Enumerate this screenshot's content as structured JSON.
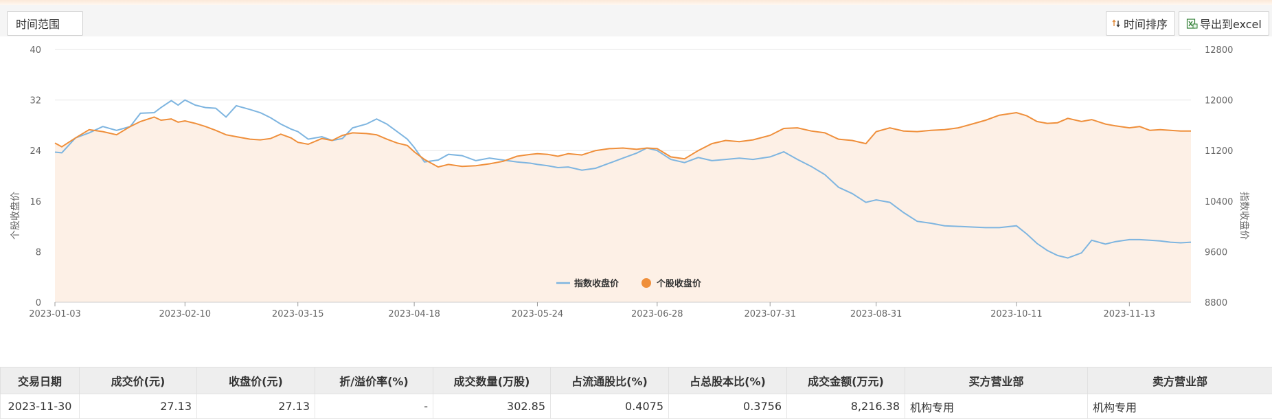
{
  "toolbar": {
    "range_label": "时间范围",
    "sort_label": "时间排序",
    "export_label": "导出到excel"
  },
  "chart_data": {
    "type": "line",
    "x_ticks": [
      "2023-01-03",
      "2023-02-10",
      "2023-03-15",
      "2023-04-18",
      "2023-05-24",
      "2023-06-28",
      "2023-07-31",
      "2023-08-31",
      "2023-10-11",
      "2023-11-13"
    ],
    "x_range": [
      "2023-01-03",
      "2023-12-01"
    ],
    "y_left": {
      "label": "个股收盘价",
      "range": [
        0,
        40
      ],
      "ticks": [
        0,
        8,
        16,
        24,
        32,
        40
      ]
    },
    "y_right": {
      "label": "指数收盘价",
      "range": [
        8800,
        12800
      ],
      "ticks": [
        8800,
        9600,
        10400,
        11200,
        12000,
        12800
      ]
    },
    "grid": true,
    "legend_position": "bottom-center",
    "series": [
      {
        "name": "指数收盘价",
        "axis": "right",
        "color": "#7eb5e0",
        "points": [
          [
            "2023-01-03",
            11175
          ],
          [
            "2023-01-05",
            11165
          ],
          [
            "2023-01-09",
            11400
          ],
          [
            "2023-01-13",
            11480
          ],
          [
            "2023-01-17",
            11580
          ],
          [
            "2023-01-21",
            11520
          ],
          [
            "2023-01-25",
            11580
          ],
          [
            "2023-01-28",
            11790
          ],
          [
            "2023-02-01",
            11800
          ],
          [
            "2023-02-03",
            11880
          ],
          [
            "2023-02-06",
            11990
          ],
          [
            "2023-02-08",
            11920
          ],
          [
            "2023-02-10",
            12000
          ],
          [
            "2023-02-13",
            11920
          ],
          [
            "2023-02-16",
            11880
          ],
          [
            "2023-02-19",
            11870
          ],
          [
            "2023-02-22",
            11730
          ],
          [
            "2023-02-25",
            11910
          ],
          [
            "2023-03-01",
            11850
          ],
          [
            "2023-03-04",
            11800
          ],
          [
            "2023-03-07",
            11720
          ],
          [
            "2023-03-10",
            11620
          ],
          [
            "2023-03-13",
            11540
          ],
          [
            "2023-03-15",
            11500
          ],
          [
            "2023-03-18",
            11380
          ],
          [
            "2023-03-22",
            11420
          ],
          [
            "2023-03-25",
            11360
          ],
          [
            "2023-03-28",
            11390
          ],
          [
            "2023-03-31",
            11560
          ],
          [
            "2023-04-04",
            11620
          ],
          [
            "2023-04-07",
            11700
          ],
          [
            "2023-04-10",
            11620
          ],
          [
            "2023-04-13",
            11500
          ],
          [
            "2023-04-16",
            11380
          ],
          [
            "2023-04-18",
            11250
          ],
          [
            "2023-04-21",
            11020
          ],
          [
            "2023-04-25",
            11050
          ],
          [
            "2023-04-28",
            11140
          ],
          [
            "2023-05-02",
            11120
          ],
          [
            "2023-05-06",
            11040
          ],
          [
            "2023-05-10",
            11080
          ],
          [
            "2023-05-14",
            11050
          ],
          [
            "2023-05-18",
            11020
          ],
          [
            "2023-05-22",
            11000
          ],
          [
            "2023-05-24",
            10980
          ],
          [
            "2023-05-27",
            10960
          ],
          [
            "2023-05-30",
            10930
          ],
          [
            "2023-06-02",
            10940
          ],
          [
            "2023-06-06",
            10890
          ],
          [
            "2023-06-10",
            10920
          ],
          [
            "2023-06-14",
            11000
          ],
          [
            "2023-06-18",
            11080
          ],
          [
            "2023-06-22",
            11160
          ],
          [
            "2023-06-25",
            11240
          ],
          [
            "2023-06-28",
            11200
          ],
          [
            "2023-07-02",
            11060
          ],
          [
            "2023-07-06",
            11010
          ],
          [
            "2023-07-10",
            11090
          ],
          [
            "2023-07-14",
            11040
          ],
          [
            "2023-07-18",
            11060
          ],
          [
            "2023-07-22",
            11080
          ],
          [
            "2023-07-26",
            11060
          ],
          [
            "2023-07-31",
            11100
          ],
          [
            "2023-08-04",
            11180
          ],
          [
            "2023-08-08",
            11060
          ],
          [
            "2023-08-12",
            10950
          ],
          [
            "2023-08-16",
            10820
          ],
          [
            "2023-08-20",
            10620
          ],
          [
            "2023-08-24",
            10520
          ],
          [
            "2023-08-28",
            10380
          ],
          [
            "2023-08-31",
            10420
          ],
          [
            "2023-09-04",
            10380
          ],
          [
            "2023-09-08",
            10220
          ],
          [
            "2023-09-12",
            10080
          ],
          [
            "2023-09-16",
            10050
          ],
          [
            "2023-09-20",
            10010
          ],
          [
            "2023-09-24",
            10000
          ],
          [
            "2023-09-28",
            9990
          ],
          [
            "2023-10-02",
            9980
          ],
          [
            "2023-10-06",
            9980
          ],
          [
            "2023-10-11",
            10010
          ],
          [
            "2023-10-14",
            9880
          ],
          [
            "2023-10-17",
            9730
          ],
          [
            "2023-10-20",
            9620
          ],
          [
            "2023-10-23",
            9540
          ],
          [
            "2023-10-26",
            9500
          ],
          [
            "2023-10-30",
            9580
          ],
          [
            "2023-11-02",
            9780
          ],
          [
            "2023-11-06",
            9720
          ],
          [
            "2023-11-09",
            9760
          ],
          [
            "2023-11-13",
            9790
          ],
          [
            "2023-11-16",
            9790
          ],
          [
            "2023-11-19",
            9780
          ],
          [
            "2023-11-22",
            9770
          ],
          [
            "2023-11-25",
            9750
          ],
          [
            "2023-11-28",
            9740
          ],
          [
            "2023-12-01",
            9750
          ]
        ]
      },
      {
        "name": "个股收盘价",
        "axis": "left",
        "color": "#ef8f3b",
        "points": [
          [
            "2023-01-03",
            25.2
          ],
          [
            "2023-01-05",
            24.6
          ],
          [
            "2023-01-09",
            26.0
          ],
          [
            "2023-01-13",
            27.3
          ],
          [
            "2023-01-17",
            27.0
          ],
          [
            "2023-01-21",
            26.5
          ],
          [
            "2023-01-25",
            27.8
          ],
          [
            "2023-01-28",
            28.6
          ],
          [
            "2023-02-01",
            29.3
          ],
          [
            "2023-02-03",
            28.8
          ],
          [
            "2023-02-06",
            29.0
          ],
          [
            "2023-02-08",
            28.5
          ],
          [
            "2023-02-10",
            28.7
          ],
          [
            "2023-02-13",
            28.3
          ],
          [
            "2023-02-16",
            27.8
          ],
          [
            "2023-02-19",
            27.2
          ],
          [
            "2023-02-22",
            26.5
          ],
          [
            "2023-02-25",
            26.2
          ],
          [
            "2023-03-01",
            25.8
          ],
          [
            "2023-03-04",
            25.7
          ],
          [
            "2023-03-07",
            25.9
          ],
          [
            "2023-03-10",
            26.6
          ],
          [
            "2023-03-13",
            26.0
          ],
          [
            "2023-03-15",
            25.3
          ],
          [
            "2023-03-18",
            25.0
          ],
          [
            "2023-03-22",
            25.9
          ],
          [
            "2023-03-25",
            25.6
          ],
          [
            "2023-03-28",
            26.4
          ],
          [
            "2023-03-31",
            26.8
          ],
          [
            "2023-04-04",
            26.7
          ],
          [
            "2023-04-07",
            26.5
          ],
          [
            "2023-04-10",
            25.8
          ],
          [
            "2023-04-13",
            25.2
          ],
          [
            "2023-04-16",
            24.8
          ],
          [
            "2023-04-18",
            23.8
          ],
          [
            "2023-04-21",
            22.6
          ],
          [
            "2023-04-25",
            21.4
          ],
          [
            "2023-04-28",
            21.8
          ],
          [
            "2023-05-02",
            21.5
          ],
          [
            "2023-05-06",
            21.6
          ],
          [
            "2023-05-10",
            21.9
          ],
          [
            "2023-05-14",
            22.3
          ],
          [
            "2023-05-18",
            23.1
          ],
          [
            "2023-05-22",
            23.4
          ],
          [
            "2023-05-24",
            23.5
          ],
          [
            "2023-05-27",
            23.4
          ],
          [
            "2023-05-30",
            23.1
          ],
          [
            "2023-06-02",
            23.5
          ],
          [
            "2023-06-06",
            23.3
          ],
          [
            "2023-06-10",
            24.0
          ],
          [
            "2023-06-14",
            24.3
          ],
          [
            "2023-06-18",
            24.4
          ],
          [
            "2023-06-22",
            24.2
          ],
          [
            "2023-06-25",
            24.4
          ],
          [
            "2023-06-28",
            24.3
          ],
          [
            "2023-07-02",
            23.0
          ],
          [
            "2023-07-06",
            22.7
          ],
          [
            "2023-07-10",
            24.0
          ],
          [
            "2023-07-14",
            25.1
          ],
          [
            "2023-07-18",
            25.6
          ],
          [
            "2023-07-22",
            25.4
          ],
          [
            "2023-07-26",
            25.7
          ],
          [
            "2023-07-31",
            26.4
          ],
          [
            "2023-08-04",
            27.5
          ],
          [
            "2023-08-08",
            27.6
          ],
          [
            "2023-08-12",
            27.1
          ],
          [
            "2023-08-16",
            26.8
          ],
          [
            "2023-08-20",
            25.8
          ],
          [
            "2023-08-24",
            25.6
          ],
          [
            "2023-08-28",
            25.1
          ],
          [
            "2023-08-31",
            27.0
          ],
          [
            "2023-09-04",
            27.6
          ],
          [
            "2023-09-08",
            27.1
          ],
          [
            "2023-09-12",
            27.0
          ],
          [
            "2023-09-16",
            27.2
          ],
          [
            "2023-09-20",
            27.3
          ],
          [
            "2023-09-24",
            27.6
          ],
          [
            "2023-09-28",
            28.2
          ],
          [
            "2023-10-02",
            28.8
          ],
          [
            "2023-10-06",
            29.6
          ],
          [
            "2023-10-11",
            30.0
          ],
          [
            "2023-10-14",
            29.5
          ],
          [
            "2023-10-17",
            28.6
          ],
          [
            "2023-10-20",
            28.3
          ],
          [
            "2023-10-23",
            28.4
          ],
          [
            "2023-10-26",
            29.1
          ],
          [
            "2023-10-30",
            28.6
          ],
          [
            "2023-11-02",
            28.9
          ],
          [
            "2023-11-06",
            28.2
          ],
          [
            "2023-11-09",
            27.9
          ],
          [
            "2023-11-13",
            27.6
          ],
          [
            "2023-11-16",
            27.8
          ],
          [
            "2023-11-19",
            27.2
          ],
          [
            "2023-11-22",
            27.3
          ],
          [
            "2023-11-25",
            27.2
          ],
          [
            "2023-11-28",
            27.1
          ],
          [
            "2023-12-01",
            27.1
          ]
        ]
      }
    ]
  },
  "table": {
    "headers": [
      "交易日期",
      "成交价(元)",
      "收盘价(元)",
      "折/溢价率(%)",
      "成交数量(万股)",
      "占流通股比(%)",
      "占总股本比(%)",
      "成交金额(万元)",
      "买方营业部",
      "卖方营业部"
    ],
    "rows": [
      [
        "2023-11-30",
        "27.13",
        "27.13",
        "-",
        "302.85",
        "0.4075",
        "0.3756",
        "8,216.38",
        "机构专用",
        "机构专用"
      ]
    ]
  }
}
